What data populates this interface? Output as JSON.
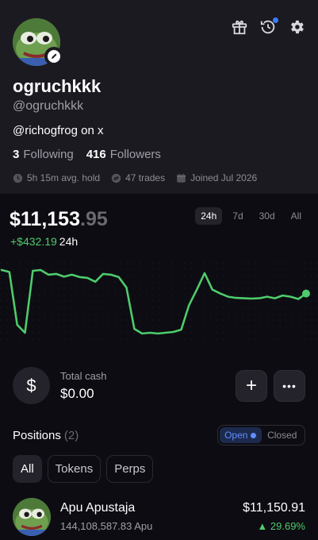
{
  "profile": {
    "display_name": "ogruchkkk",
    "handle": "@ogruchkkk",
    "x_handle": "@richogfrog on x",
    "following_count": "3",
    "following_label": "Following",
    "followers_count": "416",
    "followers_label": "Followers",
    "avg_hold": "5h 15m avg. hold",
    "trades": "47 trades",
    "joined": "Joined Jul 2026"
  },
  "icons": {
    "gift": "gift-icon",
    "history": "history-icon",
    "settings": "gear-icon",
    "edit": "pencil-icon"
  },
  "balance": {
    "dollars": "$11,153",
    "cents": ".95",
    "change": "+$432.19",
    "change_period": "24h"
  },
  "time_ranges": [
    "24h",
    "7d",
    "30d",
    "All"
  ],
  "selected_range": "24h",
  "chart_data": {
    "type": "line",
    "title": "",
    "xlabel": "",
    "ylabel": "",
    "color": "#4ecb6c",
    "x": [
      0,
      1,
      2,
      3,
      4,
      5,
      6,
      7,
      8,
      9,
      10,
      11,
      12,
      13,
      14,
      15,
      16,
      17,
      18,
      19,
      20,
      21,
      22,
      23,
      24,
      25,
      26,
      27,
      28,
      29,
      30,
      31,
      32,
      33,
      34,
      35,
      36,
      37,
      38,
      39,
      40,
      41,
      42,
      43,
      44,
      45,
      46,
      47,
      48,
      49
    ],
    "values": [
      10790,
      10785,
      10650,
      10630,
      10788,
      10790,
      10778,
      10780,
      10773,
      10778,
      10772,
      10770,
      10760,
      10780,
      10778,
      10772,
      10745,
      10640,
      10628,
      10630,
      10628,
      10630,
      10632,
      10638,
      10700,
      10740,
      10782,
      10740,
      10730,
      10722,
      10719,
      10718,
      10717,
      10718,
      10722,
      10718,
      10725,
      10722,
      10716,
      10730
    ]
  },
  "cash": {
    "label": "Total cash",
    "value": "$0.00",
    "add_symbol": "+",
    "more_symbol": "•••"
  },
  "positions": {
    "title": "Positions",
    "count": "(2)",
    "open_label": "Open",
    "closed_label": "Closed",
    "filters": [
      "All",
      "Tokens",
      "Perps"
    ],
    "selected_filter": "All",
    "items": [
      {
        "name": "Apu Apustaja",
        "amount": "144,108,587.83 Apu",
        "value": "$11,150.91",
        "change": "▲ 29.69%"
      }
    ]
  }
}
